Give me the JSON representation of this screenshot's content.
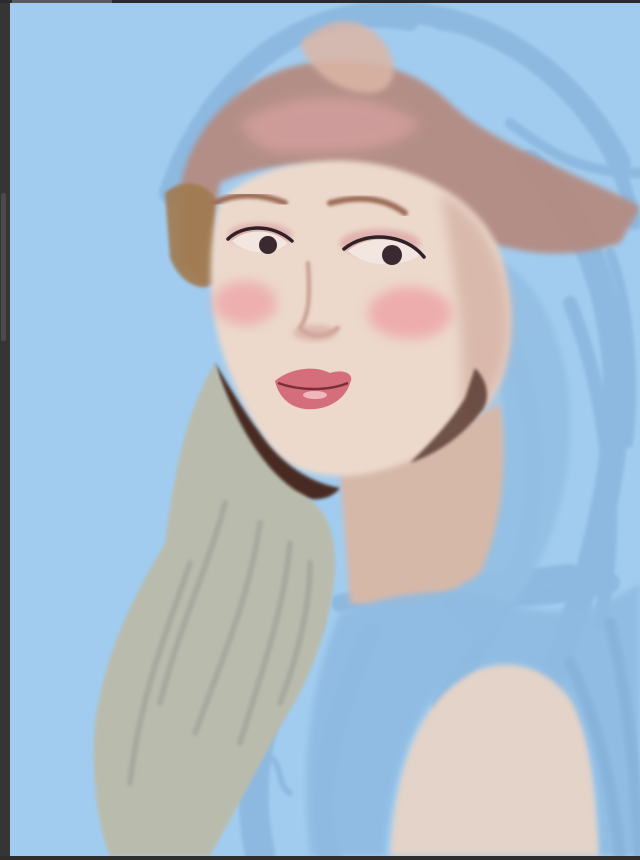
{
  "app": {
    "type": "digital painting application",
    "canvas_background": "#a1ccef"
  },
  "canvas": {
    "artwork_description": "",
    "palette": {
      "background_blue": "#a1ccef",
      "hair_stroke_blue": "#8ab6de",
      "hair_brown": "#b48b82",
      "skin_light": "#ecd9cc",
      "skin_shadow": "#d3aea2",
      "blush": "#ee9fa3",
      "lips": "#d56e7b",
      "eyes": "#3a2a30",
      "sleeve_gray_green": "#b9bcad",
      "dark_shadow": "#4a2a24",
      "shoulder": "#e3d3c8"
    }
  },
  "ui": {
    "side_panel_handle": "panel-resize-handle",
    "top_tab": "document-tab"
  }
}
